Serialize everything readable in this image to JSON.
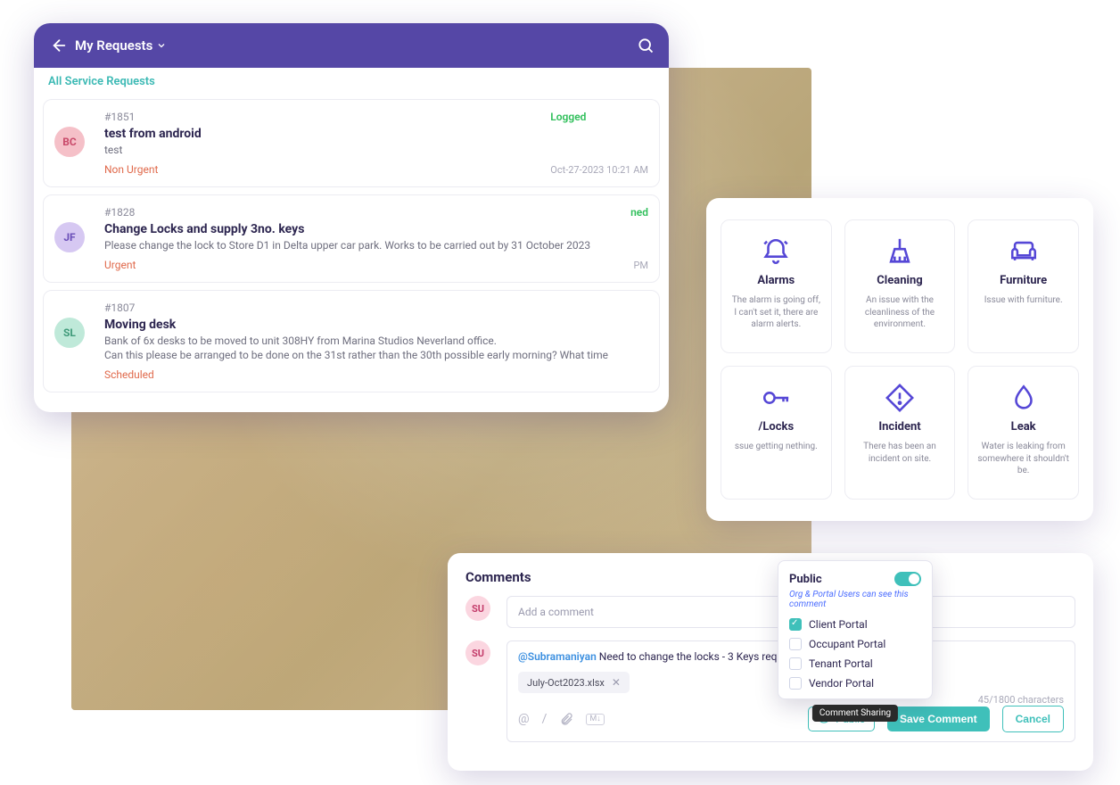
{
  "requests_panel": {
    "title": "My Requests",
    "subtitle": "All Service Requests",
    "items": [
      {
        "id": "#1851",
        "title": "test from android",
        "desc": "test",
        "priority": "Non Urgent",
        "status": "Logged",
        "status_color": "#2fbf5a",
        "time": "Oct-27-2023 10:21 AM",
        "avatar": "BC",
        "avatar_bg": "#f5c0c8",
        "avatar_fg": "#c94a6a"
      },
      {
        "id": "#1828",
        "title": "Change Locks and supply 3no. keys",
        "desc": "Please change the lock to Store D1 in Delta upper car park.  Works to be carried out by 31 October 2023",
        "priority": "Urgent",
        "status": "ned",
        "status_color": "#2fbf5a",
        "time": "PM",
        "avatar": "JF",
        "avatar_bg": "#d6c8f2",
        "avatar_fg": "#6a4fb8"
      },
      {
        "id": "#1807",
        "title": "Moving desk",
        "desc": "Bank of 6x desks to be moved to unit 308HY from Marina Studios Neverland office.\nCan this please be arranged to be done on the 31st rather than the 30th possible early morning? What time",
        "priority": "Scheduled",
        "status": "",
        "status_color": "",
        "time": "",
        "avatar": "SL",
        "avatar_bg": "#bfe9d9",
        "avatar_fg": "#3f9a7a"
      }
    ]
  },
  "categories_panel": {
    "items": [
      {
        "icon": "alarm-icon",
        "name": "Alarms",
        "desc": "The alarm is going off, I can't set it, there are alarm alerts."
      },
      {
        "icon": "broom-icon",
        "name": "Cleaning",
        "desc": "An issue with the cleanliness of the environment."
      },
      {
        "icon": "sofa-icon",
        "name": "Furniture",
        "desc": "Issue with furniture."
      },
      {
        "icon": "key-icon",
        "name": "/Locks",
        "desc": "ssue getting nething."
      },
      {
        "icon": "warning-icon",
        "name": "Incident",
        "desc": "There has been an incident on site."
      },
      {
        "icon": "drop-icon",
        "name": "Leak",
        "desc": "Water is leaking from somewhere it shouldn't be."
      }
    ]
  },
  "comments_panel": {
    "title": "Comments",
    "placeholder": "Add a comment",
    "avatar": "SU",
    "thread": {
      "mention": "@Subramaniyan",
      "text": "Need to change the locks - 3 Keys required.",
      "attachment": "July-Oct2023.xlsx",
      "count": "45/1800 characters"
    },
    "buttons": {
      "public": "Public",
      "save": "Save Comment",
      "cancel": "Cancel"
    },
    "popover": {
      "title": "Public",
      "subtitle": "Org & Portal Users can see this comment",
      "options": [
        {
          "label": "Client Portal",
          "checked": true
        },
        {
          "label": "Occupant Portal",
          "checked": false
        },
        {
          "label": "Tenant Portal",
          "checked": false
        },
        {
          "label": "Vendor Portal",
          "checked": false
        }
      ],
      "tooltip": "Comment Sharing"
    }
  }
}
